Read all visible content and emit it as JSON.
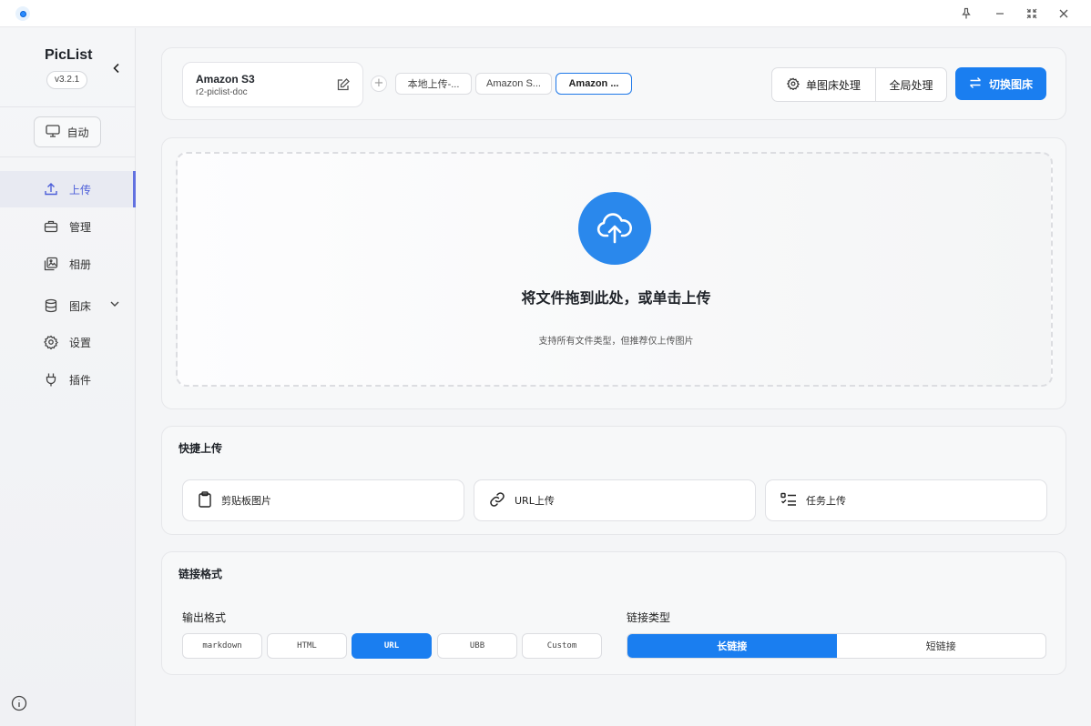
{
  "window": {
    "controls": [
      "pin",
      "minimize",
      "restore",
      "close"
    ]
  },
  "sidebar": {
    "app_name": "PicList",
    "version": "v3.2.1",
    "mode_button": "自动",
    "nav": [
      {
        "label": "上传",
        "icon": "upload-icon",
        "active": true
      },
      {
        "label": "管理",
        "icon": "briefcase-icon",
        "active": false
      },
      {
        "label": "相册",
        "icon": "gallery-icon",
        "active": false
      },
      {
        "label": "图床",
        "icon": "database-icon",
        "active": false,
        "expandable": true
      },
      {
        "label": "设置",
        "icon": "gear-icon",
        "active": false
      },
      {
        "label": "插件",
        "icon": "plug-icon",
        "active": false
      }
    ]
  },
  "header": {
    "current_host": {
      "name": "Amazon S3",
      "config": "r2-piclist-doc"
    },
    "host_tabs": [
      "本地上传-...",
      "Amazon S...",
      "Amazon ..."
    ],
    "active_tab_index": 2,
    "single_process": "单图床处理",
    "global_process": "全局处理",
    "switch_host": "切换图床"
  },
  "upload": {
    "title": "将文件拖到此处，或单击上传",
    "subtitle": "支持所有文件类型，但推荐仅上传图片"
  },
  "quick_upload": {
    "title": "快捷上传",
    "buttons": [
      {
        "label": "剪贴板图片",
        "icon": "clipboard-icon"
      },
      {
        "label": "URL上传",
        "icon": "link-icon"
      },
      {
        "label": "任务上传",
        "icon": "checklist-icon"
      }
    ]
  },
  "link_format": {
    "title": "链接格式",
    "output_label": "输出格式",
    "formats": [
      "markdown",
      "HTML",
      "URL",
      "UBB",
      "Custom"
    ],
    "active_format": "URL",
    "link_type_label": "链接类型",
    "link_types": [
      "长链接",
      "短链接"
    ],
    "active_link_type": "长链接"
  },
  "colors": {
    "accent": "#1a7ef0",
    "nav_active": "#4d5fd9"
  }
}
